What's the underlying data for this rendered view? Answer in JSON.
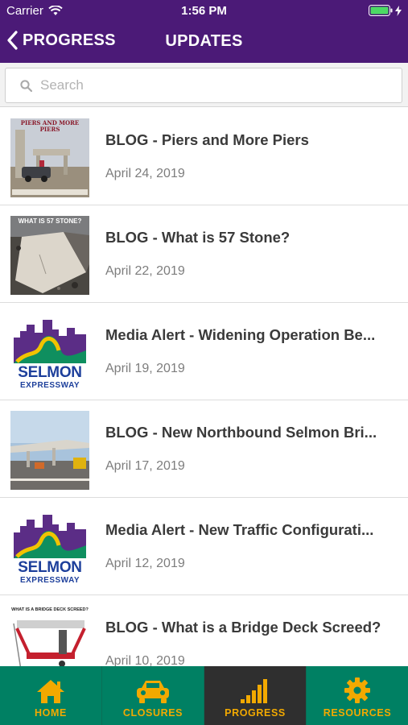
{
  "status": {
    "carrier": "Carrier",
    "time": "1:56 PM"
  },
  "nav": {
    "back_label": "PROGRESS",
    "title": "UPDATES"
  },
  "search": {
    "placeholder": "Search"
  },
  "items": [
    {
      "title": "BLOG - Piers and More Piers",
      "date": "April 24, 2019",
      "thumb_text": "PIERS AND MORE PIERS"
    },
    {
      "title": "BLOG - What is 57 Stone?",
      "date": "April 22, 2019",
      "thumb_text": "WHAT IS 57 STONE?"
    },
    {
      "title": "Media Alert - Widening Operation Be...",
      "date": "April 19, 2019",
      "thumb_text": "SELMON",
      "thumb_subtext": "EXPRESSWAY"
    },
    {
      "title": "BLOG - New Northbound Selmon Bri...",
      "date": "April 17, 2019"
    },
    {
      "title": "Media Alert - New Traffic Configurati...",
      "date": "April 12, 2019",
      "thumb_text": "SELMON",
      "thumb_subtext": "EXPRESSWAY"
    },
    {
      "title": "BLOG - What is a Bridge Deck Screed?",
      "date": "April 10, 2019",
      "thumb_text": "WHAT IS A BRIDGE DECK SCREED?"
    }
  ],
  "tabs": [
    {
      "label": "HOME",
      "icon": "home-icon"
    },
    {
      "label": "CLOSURES",
      "icon": "car-icon"
    },
    {
      "label": "PROGRESS",
      "icon": "signal-bars-icon"
    },
    {
      "label": "RESOURCES",
      "icon": "gear-icon"
    }
  ],
  "colors": {
    "brand_purple": "#4b1a77",
    "tab_green": "#008063",
    "tab_accent": "#f2a900",
    "active_tab": "#2f2f2f"
  }
}
